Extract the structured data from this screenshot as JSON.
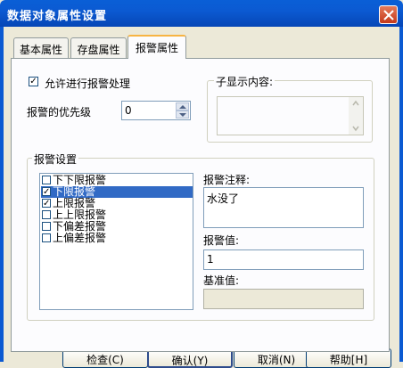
{
  "window": {
    "title": "数据对象属性设置"
  },
  "tabs": [
    "基本属性",
    "存盘属性",
    "报警属性"
  ],
  "alarm": {
    "enable_label": "允许进行报警处理",
    "enable_checked": "✓",
    "priority_label": "报警的优先级",
    "priority_value": "0"
  },
  "sub_display": {
    "title": "子显示内容:"
  },
  "settings": {
    "title": "报警设置",
    "items": [
      {
        "label": "下下限报警",
        "mark": ""
      },
      {
        "label": "下限报警",
        "mark": "✓"
      },
      {
        "label": "上限报警",
        "mark": "✓"
      },
      {
        "label": "上上限报警",
        "mark": ""
      },
      {
        "label": "下偏差报警",
        "mark": ""
      },
      {
        "label": "上偏差报警",
        "mark": ""
      }
    ],
    "note_label": "报警注释:",
    "note_value": "水没了",
    "value_label": "报警值:",
    "value": "1",
    "base_label": "基准值:",
    "base_value": ""
  },
  "buttons": {
    "check": "检查(C)",
    "ok": "确认(Y)",
    "cancel": "取消(N)",
    "help": "帮助[H]"
  },
  "colors": {
    "titlebar": "#0b5ad2",
    "selection": "#316ac5"
  }
}
